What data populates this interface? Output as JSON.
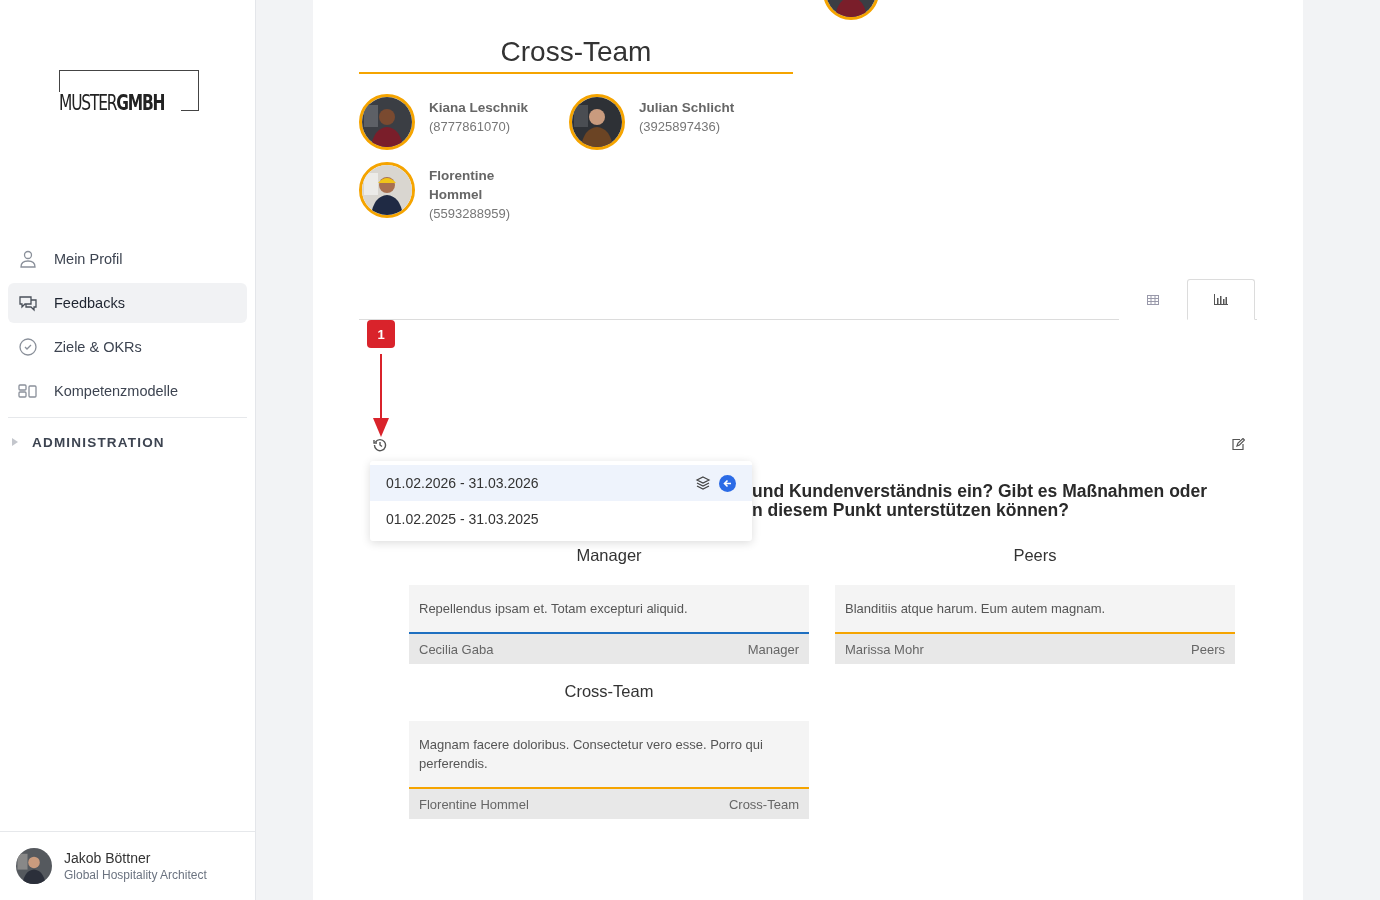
{
  "logo": "MUSTER**GMBH**",
  "nav": [
    {
      "label": "Mein Profil",
      "selected": false
    },
    {
      "label": "Feedbacks",
      "selected": true
    },
    {
      "label": "Ziele & OKRs",
      "selected": false
    },
    {
      "label": "Kompetenzmodelle",
      "selected": false
    }
  ],
  "admin_section": {
    "label": "ADMINISTRATION",
    "expanded": false
  },
  "user": {
    "name": "Jakob Böttner",
    "role": "Global Hospitality Architect"
  },
  "team": {
    "title": "Cross-Team",
    "members": [
      {
        "name": "Kiana Leschnik",
        "id": "(8777861070)"
      },
      {
        "name": "Julian Schlicht",
        "id": "(3925897436)"
      },
      {
        "name": "Florentine Hommel",
        "id": "(5593288959)"
      }
    ]
  },
  "view_tabs": [
    {
      "selected": false
    },
    {
      "selected": true
    }
  ],
  "callout": {
    "number": "1"
  },
  "periods": [
    {
      "label": "01.02.2026 - 31.03.2026",
      "selected": true
    },
    {
      "label": "01.02.2025 - 31.03.2025",
      "selected": false
    }
  ],
  "question_lines": [
    "und Kundenverständnis ein? Gibt es Maßnahmen oder",
    "n diesem Punkt unterstützen können?"
  ],
  "groups": [
    {
      "title": "Manager",
      "color": "#1e6fc0",
      "feedbacks": [
        {
          "text": "Repellendus ipsam et. Totam excepturi aliquid.",
          "author": "Cecilia Gaba",
          "role": "Manager"
        }
      ]
    },
    {
      "title": "Peers",
      "color": "#f5a400",
      "feedbacks": [
        {
          "text": "Blanditiis atque harum. Eum autem magnam.",
          "author": "Marissa Mohr",
          "role": "Peers"
        }
      ]
    },
    {
      "title": "Cross-Team",
      "color": "#f5a400",
      "feedbacks": [
        {
          "text": "Magnam facere doloribus. Consectetur vero esse. Porro qui perferendis.",
          "author": "Florentine Hommel",
          "role": "Cross-Team"
        }
      ]
    }
  ]
}
